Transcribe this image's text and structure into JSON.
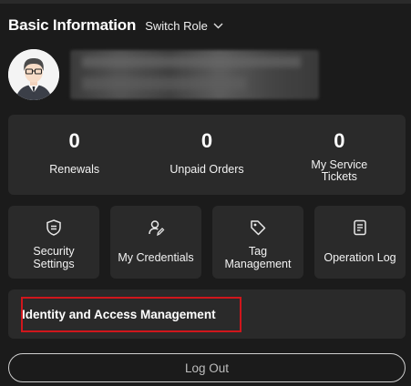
{
  "header": {
    "title": "Basic Information",
    "switch_role_label": "Switch Role"
  },
  "profile": {
    "avatar_icon": "user-avatar-icon",
    "name_redacted": true
  },
  "stats": [
    {
      "value": "0",
      "label": "Renewals"
    },
    {
      "value": "0",
      "label": "Unpaid Orders"
    },
    {
      "value": "0",
      "label": "My Service Tickets"
    }
  ],
  "tiles": [
    {
      "label": "Security Settings",
      "icon": "shield-icon"
    },
    {
      "label": "My Credentials",
      "icon": "credentials-icon"
    },
    {
      "label": "Tag Management",
      "icon": "tag-icon"
    },
    {
      "label": "Operation Log",
      "icon": "log-icon"
    }
  ],
  "iam": {
    "label": "Identity and Access Management",
    "highlight_color": "#d0161c"
  },
  "logout": {
    "label": "Log Out"
  }
}
